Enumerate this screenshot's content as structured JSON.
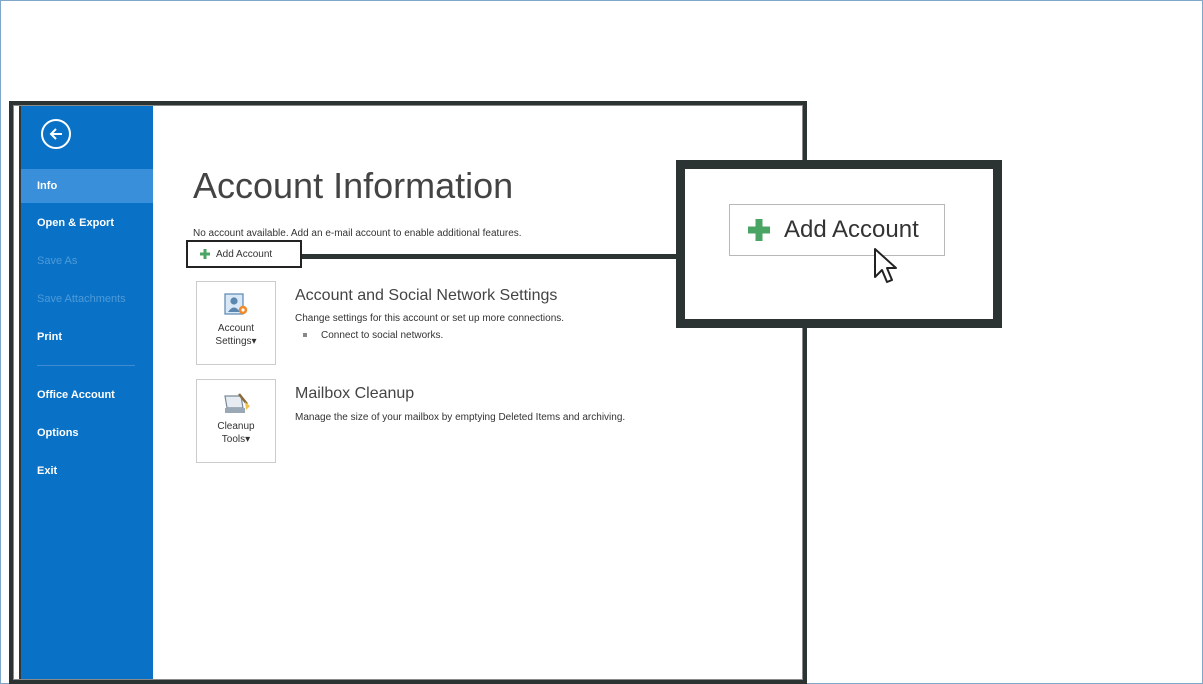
{
  "sidebar": {
    "items": [
      {
        "label": "Info"
      },
      {
        "label": "Open & Export"
      },
      {
        "label": "Save As"
      },
      {
        "label": "Save Attachments"
      },
      {
        "label": "Print"
      },
      {
        "label": "Office Account"
      },
      {
        "label": "Options"
      },
      {
        "label": "Exit"
      }
    ]
  },
  "main": {
    "title": "Account Information",
    "info_text": "No account available. Add an e-mail account to enable additional features.",
    "add_account_label": "Add Account",
    "sections": [
      {
        "tile_line1": "Account",
        "tile_line2": "Settings",
        "heading": "Account and Social Network Settings",
        "description": "Change settings for this account or set up more connections.",
        "bullet": "Connect to social networks."
      },
      {
        "tile_line1": "Cleanup",
        "tile_line2": "Tools",
        "heading": "Mailbox Cleanup",
        "description": "Manage the size of your mailbox by emptying Deleted Items and archiving."
      }
    ]
  },
  "callout": {
    "button_label": "Add Account"
  },
  "colors": {
    "sidebar": "#0a72c6",
    "selected_item": "#3a8fda",
    "plus_icon": "#4aa564",
    "frame": "#2c3333"
  }
}
